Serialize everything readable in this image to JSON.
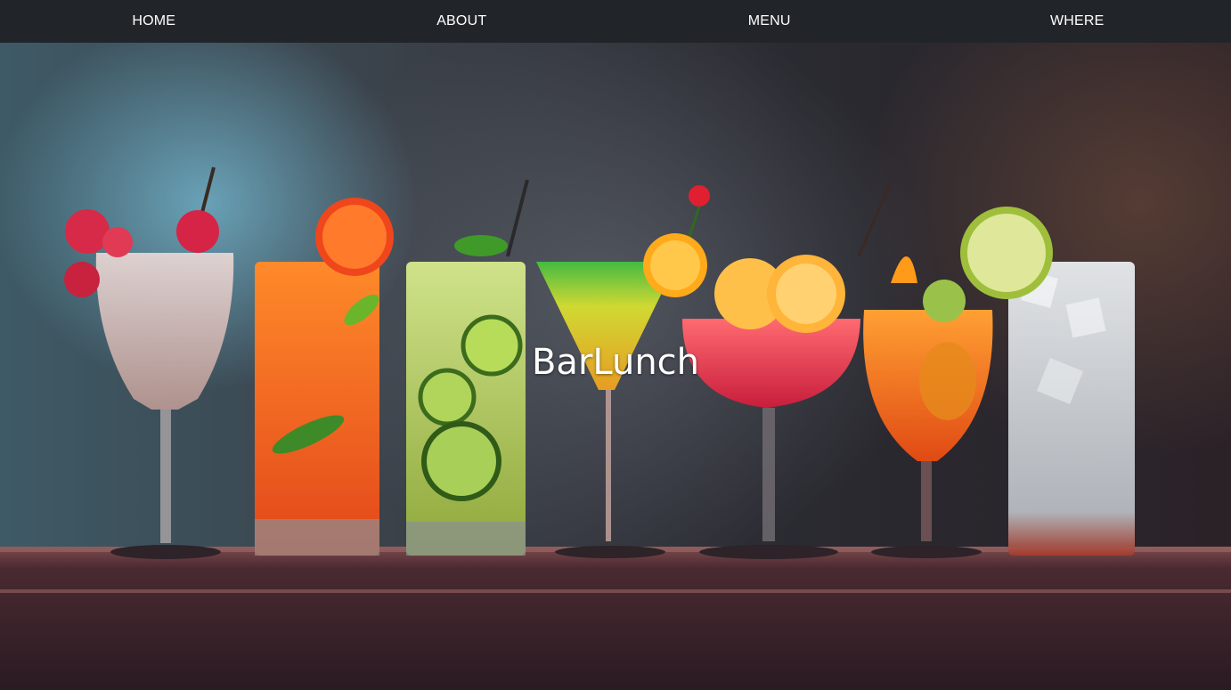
{
  "nav": {
    "items": [
      {
        "label": "HOME"
      },
      {
        "label": "ABOUT"
      },
      {
        "label": "MENU"
      },
      {
        "label": "WHERE"
      }
    ]
  },
  "hero": {
    "title": "BarLunch",
    "background_description_icon": "cocktail-lineup-image"
  },
  "colors": {
    "navbar_bg": "#212529",
    "nav_text": "#ffffff",
    "title_text": "#ffffff"
  }
}
